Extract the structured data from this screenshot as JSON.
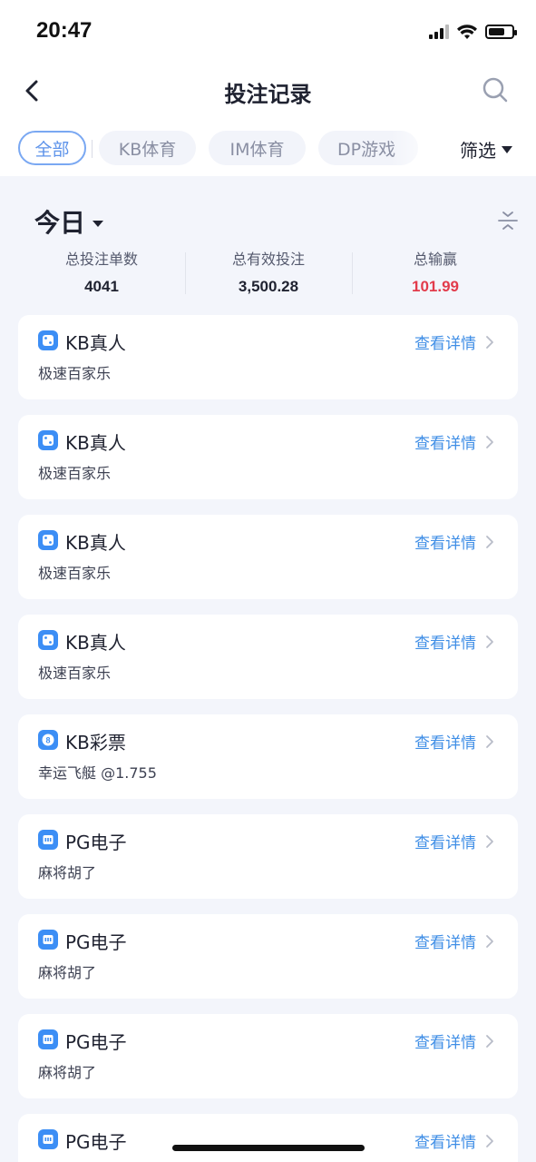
{
  "status_bar": {
    "time": "20:47"
  },
  "header": {
    "title": "投注记录"
  },
  "tabs": [
    {
      "label": "全部",
      "active": true
    },
    {
      "label": "KB体育",
      "active": false
    },
    {
      "label": "IM体育",
      "active": false
    },
    {
      "label": "DP游戏",
      "active": false
    }
  ],
  "filter": {
    "label": "筛选"
  },
  "summary": {
    "period": "今日",
    "stats": [
      {
        "label": "总投注单数",
        "value": "4041",
        "color": "#1f2230"
      },
      {
        "label": "总有效投注",
        "value": "3,500.28",
        "color": "#1f2230"
      },
      {
        "label": "总输赢",
        "value": "101.99",
        "color": "#e23b4b"
      }
    ]
  },
  "records": [
    {
      "icon": "dice-icon",
      "platform": "KB真人",
      "game": "极速百家乐",
      "link": "查看详情"
    },
    {
      "icon": "dice-icon",
      "platform": "KB真人",
      "game": "极速百家乐",
      "link": "查看详情"
    },
    {
      "icon": "dice-icon",
      "platform": "KB真人",
      "game": "极速百家乐",
      "link": "查看详情"
    },
    {
      "icon": "dice-icon",
      "platform": "KB真人",
      "game": "极速百家乐",
      "link": "查看详情"
    },
    {
      "icon": "lottery-ball-icon",
      "platform": "KB彩票",
      "game": "幸运飞艇 @1.755",
      "link": "查看详情"
    },
    {
      "icon": "slot-machine-icon",
      "platform": "PG电子",
      "game": "麻将胡了",
      "link": "查看详情"
    },
    {
      "icon": "slot-machine-icon",
      "platform": "PG电子",
      "game": "麻将胡了",
      "link": "查看详情"
    },
    {
      "icon": "slot-machine-icon",
      "platform": "PG电子",
      "game": "麻将胡了",
      "link": "查看详情"
    },
    {
      "icon": "slot-machine-icon",
      "platform": "PG电子",
      "game": "",
      "link": "查看详情"
    }
  ],
  "colors": {
    "accent": "#3f8ee6",
    "loss_win": "#e23b4b",
    "background": "#f3f5fb"
  }
}
